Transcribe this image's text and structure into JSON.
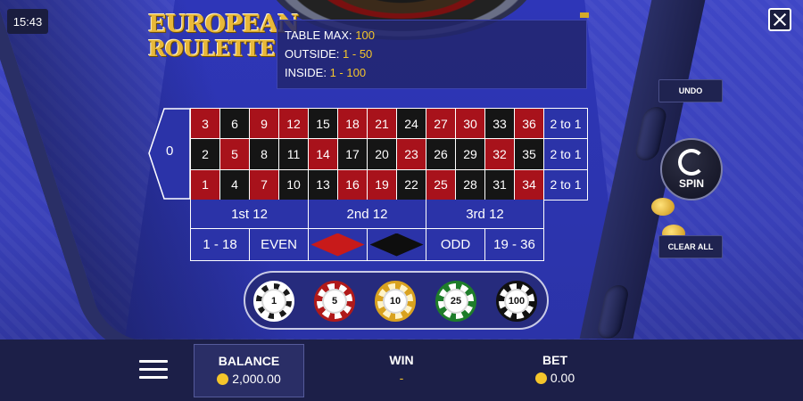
{
  "status_bar": {
    "time": "15:43"
  },
  "game": {
    "logo_line1": "EUROPEAN",
    "logo_line2": "ROULETTE"
  },
  "limits": {
    "table_max_label": "TABLE MAX:",
    "table_max": "100",
    "outside_label": "OUTSIDE:",
    "outside": "1 - 50",
    "inside_label": "INSIDE:",
    "inside": "1 - 100"
  },
  "board": {
    "zero": "0",
    "rows": [
      [
        {
          "n": "3",
          "c": "red"
        },
        {
          "n": "6",
          "c": "black"
        },
        {
          "n": "9",
          "c": "red"
        },
        {
          "n": "12",
          "c": "red"
        },
        {
          "n": "15",
          "c": "black"
        },
        {
          "n": "18",
          "c": "red"
        },
        {
          "n": "21",
          "c": "red"
        },
        {
          "n": "24",
          "c": "black"
        },
        {
          "n": "27",
          "c": "red"
        },
        {
          "n": "30",
          "c": "red"
        },
        {
          "n": "33",
          "c": "black"
        },
        {
          "n": "36",
          "c": "red"
        }
      ],
      [
        {
          "n": "2",
          "c": "black"
        },
        {
          "n": "5",
          "c": "red"
        },
        {
          "n": "8",
          "c": "black"
        },
        {
          "n": "11",
          "c": "black"
        },
        {
          "n": "14",
          "c": "red"
        },
        {
          "n": "17",
          "c": "black"
        },
        {
          "n": "20",
          "c": "black"
        },
        {
          "n": "23",
          "c": "red"
        },
        {
          "n": "26",
          "c": "black"
        },
        {
          "n": "29",
          "c": "black"
        },
        {
          "n": "32",
          "c": "red"
        },
        {
          "n": "35",
          "c": "black"
        }
      ],
      [
        {
          "n": "1",
          "c": "red"
        },
        {
          "n": "4",
          "c": "black"
        },
        {
          "n": "7",
          "c": "red"
        },
        {
          "n": "10",
          "c": "black"
        },
        {
          "n": "13",
          "c": "black"
        },
        {
          "n": "16",
          "c": "red"
        },
        {
          "n": "19",
          "c": "red"
        },
        {
          "n": "22",
          "c": "black"
        },
        {
          "n": "25",
          "c": "red"
        },
        {
          "n": "28",
          "c": "black"
        },
        {
          "n": "31",
          "c": "black"
        },
        {
          "n": "34",
          "c": "red"
        }
      ]
    ],
    "column_bet": "2 to 1",
    "dozens": [
      "1st 12",
      "2nd 12",
      "3rd 12"
    ],
    "outside": {
      "low": "1 - 18",
      "even": "EVEN",
      "red": "red",
      "black": "black",
      "odd": "ODD",
      "high": "19 - 36"
    }
  },
  "chips": [
    "1",
    "5",
    "10",
    "25",
    "100"
  ],
  "buttons": {
    "undo": "UNDO",
    "spin": "SPIN",
    "clear_all": "CLEAR ALL"
  },
  "footer": {
    "balance_label": "BALANCE",
    "balance": "2,000.00",
    "win_label": "WIN",
    "win": "-",
    "bet_label": "BET",
    "bet": "0.00"
  },
  "colors": {
    "red": "#a8121b",
    "black": "#151515",
    "felt": "#2b33a8",
    "gold": "#f4c52b"
  }
}
